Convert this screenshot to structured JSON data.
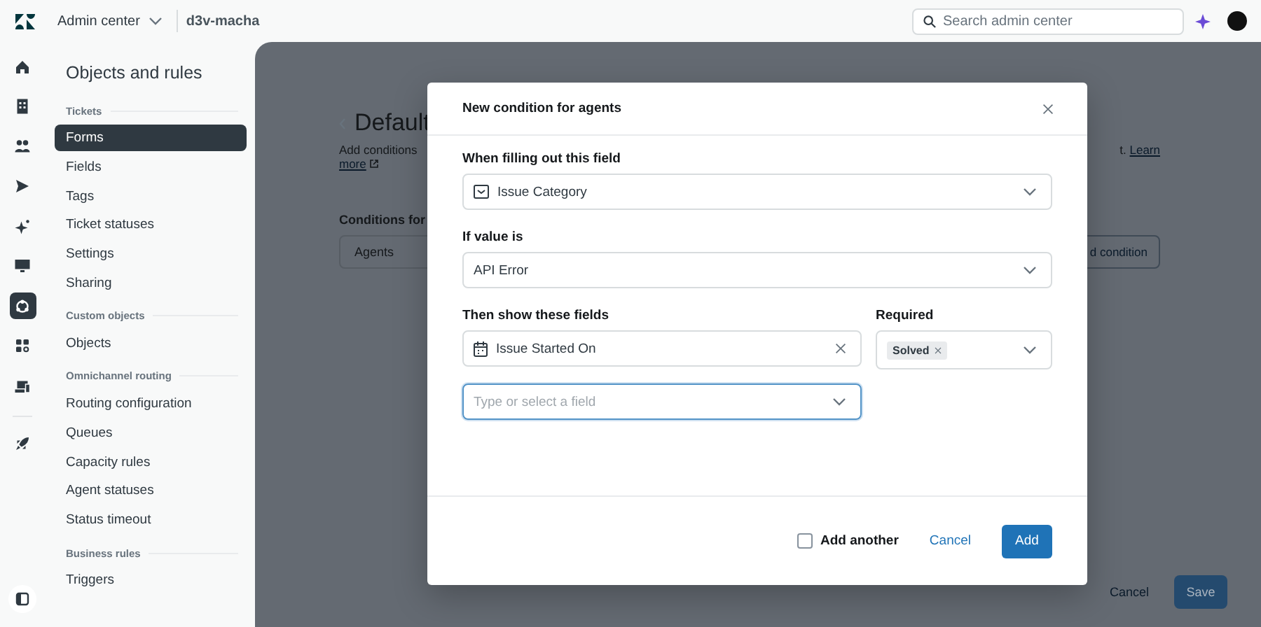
{
  "top_bar": {
    "product": "Admin center",
    "account": "d3v-macha",
    "search": {
      "placeholder": "Search admin center"
    }
  },
  "rail": {
    "items": [
      {
        "kind": "home",
        "selected": false
      },
      {
        "kind": "building",
        "selected": false
      },
      {
        "kind": "people",
        "selected": false
      },
      {
        "kind": "send",
        "selected": false
      },
      {
        "kind": "sparkle",
        "selected": false
      },
      {
        "kind": "monitor",
        "selected": false
      },
      {
        "kind": "objects",
        "selected": true
      },
      {
        "kind": "apps",
        "selected": false
      },
      {
        "kind": "routing",
        "selected": false
      },
      {
        "kind": "rocket",
        "selected": false
      }
    ]
  },
  "sidebar": {
    "title": "Objects and rules",
    "sections": [
      {
        "heading": "Tickets",
        "items": [
          {
            "label": "Forms",
            "selected": true
          },
          {
            "label": "Fields",
            "selected": false
          },
          {
            "label": "Tags",
            "selected": false
          },
          {
            "label": "Ticket statuses",
            "selected": false
          },
          {
            "label": "Settings",
            "selected": false
          },
          {
            "label": "Sharing",
            "selected": false
          }
        ]
      },
      {
        "heading": "Custom objects",
        "items": [
          {
            "label": "Objects",
            "selected": false
          }
        ]
      },
      {
        "heading": "Omnichannel routing",
        "items": [
          {
            "label": "Routing configuration",
            "selected": false
          },
          {
            "label": "Queues",
            "selected": false
          },
          {
            "label": "Capacity rules",
            "selected": false
          },
          {
            "label": "Agent statuses",
            "selected": false
          },
          {
            "label": "Status timeout",
            "selected": false
          }
        ]
      },
      {
        "heading": "Business rules",
        "items": [
          {
            "label": "Triggers",
            "selected": false
          }
        ]
      }
    ]
  },
  "page": {
    "heading": "Default",
    "description_start": "Add conditions",
    "description_end": "t.",
    "learn_more": [
      "Learn",
      "more"
    ],
    "conditions_label": "Conditions for",
    "audience_field": "Agents",
    "add_button": "d condition",
    "cancel": "Cancel",
    "save": "Save"
  },
  "modal": {
    "title": "New condition for agents",
    "field_label": "When filling out this field",
    "field": {
      "value": "Issue Category",
      "kind": "dropdown"
    },
    "value_label": "If value is",
    "value": "API Error",
    "show_label": "Then show these fields",
    "required_label": "Required",
    "shown_fields": [
      {
        "value": "Issue Started On",
        "kind": "date",
        "required": [
          "Solved"
        ]
      }
    ],
    "new_field": {
      "placeholder": "Type or select a field",
      "focused": true
    },
    "add_another": {
      "label": "Add another",
      "checked": false
    },
    "cancel": "Cancel",
    "add": "Add"
  }
}
